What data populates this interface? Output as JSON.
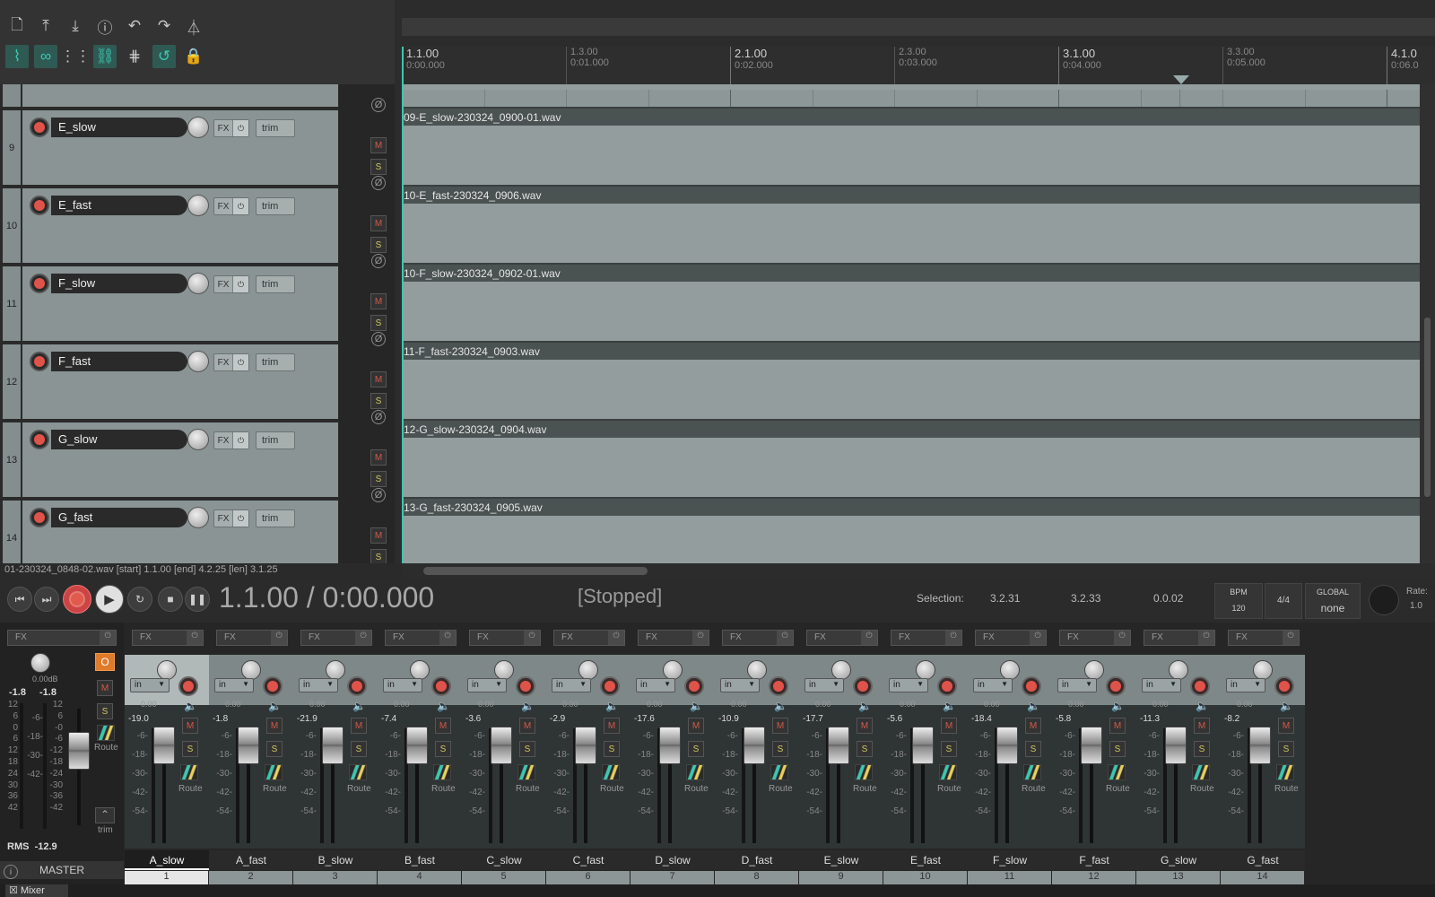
{
  "toolbar": {
    "row1": [
      "new-project-icon",
      "open-project-icon",
      "save-project-icon",
      "project-info-icon",
      "undo-icon",
      "redo-icon",
      "metronome-icon"
    ],
    "row2": [
      "ripple-edit-icon",
      "link-icon",
      "grid-icon",
      "auto-crossfade-icon",
      "snap-grid-icon",
      "loop-icon",
      "lock-icon"
    ]
  },
  "ruler": [
    {
      "bar": "1.1.00",
      "time": "0:00.000",
      "major": true
    },
    {
      "bar": "1.3.00",
      "time": "0:01.000",
      "major": false
    },
    {
      "bar": "2.1.00",
      "time": "0:02.000",
      "major": true
    },
    {
      "bar": "2.3.00",
      "time": "0:03.000",
      "major": false
    },
    {
      "bar": "3.1.00",
      "time": "0:04.000",
      "major": true
    },
    {
      "bar": "3.3.00",
      "time": "0:05.000",
      "major": false
    },
    {
      "bar": "4.1.0",
      "time": "0:06.0",
      "major": true
    }
  ],
  "tracks": [
    {
      "num": "9",
      "name": "E_slow",
      "item": "09-E_slow-230324_0900-01.wav"
    },
    {
      "num": "10",
      "name": "E_fast",
      "item": "10-E_fast-230324_0906.wav"
    },
    {
      "num": "11",
      "name": "F_slow",
      "item": "10-F_slow-230324_0902-01.wav"
    },
    {
      "num": "12",
      "name": "F_fast",
      "item": "11-F_fast-230324_0903.wav"
    },
    {
      "num": "13",
      "name": "G_slow",
      "item": "12-G_slow-230324_0904.wav"
    },
    {
      "num": "14",
      "name": "G_fast",
      "item": "13-G_fast-230324_0905.wav"
    }
  ],
  "track_controls": {
    "fx": "FX",
    "trim": "trim",
    "mute": "M",
    "solo": "S",
    "phase": "Ø"
  },
  "status_line": "01-230324_0848-02.wav [start] 1.1.00 [end] 4.2.25 [len] 3.1.25",
  "transport": {
    "position": "1.1.00 / 0:00.000",
    "state": "[Stopped]",
    "selection_label": "Selection:",
    "sel_start": "3.2.31",
    "sel_end": "3.2.33",
    "sel_len": "0.0.02",
    "bpm_label": "BPM",
    "bpm": "120",
    "time_sig": "4/4",
    "global_label": "GLOBAL",
    "global_value": "none",
    "rate_label": "Rate:",
    "rate": "1.0"
  },
  "master": {
    "fx": "FX",
    "db": "0.00dB",
    "peak_l": "-1.8",
    "peak_r": "-1.8",
    "rms_label": "RMS",
    "rms": "-12.9",
    "label": "MASTER",
    "mono": "O",
    "mute": "M",
    "solo": "S",
    "route": "Route",
    "trim": "trim",
    "scale_left": [
      "12",
      "6",
      "0",
      "6",
      "12",
      "18",
      "24",
      "30",
      "36",
      "42"
    ],
    "scale_mid": [
      "-6-",
      "-18-",
      "-30-",
      "-42-"
    ],
    "scale_right": [
      "12",
      "6",
      "-0",
      "-6",
      "-12",
      "-18",
      "-24",
      "-30",
      "-36",
      "-42"
    ]
  },
  "mixer_strip_common": {
    "fx": "FX",
    "input": "in",
    "vol": "0.00",
    "mute": "M",
    "solo": "S",
    "route": "Route",
    "scale": [
      "-6-",
      "-18-",
      "-30-",
      "-42-",
      "-54-"
    ]
  },
  "mixer_strips": [
    {
      "name": "A_slow",
      "num": "1",
      "peak": "-19.0",
      "selected": true
    },
    {
      "name": "A_fast",
      "num": "2",
      "peak": "-1.8"
    },
    {
      "name": "B_slow",
      "num": "3",
      "peak": "-21.9"
    },
    {
      "name": "B_fast",
      "num": "4",
      "peak": "-7.4"
    },
    {
      "name": "C_slow",
      "num": "5",
      "peak": "-3.6"
    },
    {
      "name": "C_fast",
      "num": "6",
      "peak": "-2.9"
    },
    {
      "name": "D_slow",
      "num": "7",
      "peak": "-17.6"
    },
    {
      "name": "D_fast",
      "num": "8",
      "peak": "-10.9"
    },
    {
      "name": "E_slow",
      "num": "9",
      "peak": "-17.7"
    },
    {
      "name": "E_fast",
      "num": "10",
      "peak": "-5.6"
    },
    {
      "name": "F_slow",
      "num": "11",
      "peak": "-18.4"
    },
    {
      "name": "F_fast",
      "num": "12",
      "peak": "-5.8"
    },
    {
      "name": "G_slow",
      "num": "13",
      "peak": "-11.3"
    },
    {
      "name": "G_fast",
      "num": "14",
      "peak": "-8.2"
    }
  ],
  "mixer_tab": "Mixer",
  "colors": {
    "accent": "#3fc6b0",
    "record": "#e0534a",
    "mono_button": "#e07b2a"
  }
}
